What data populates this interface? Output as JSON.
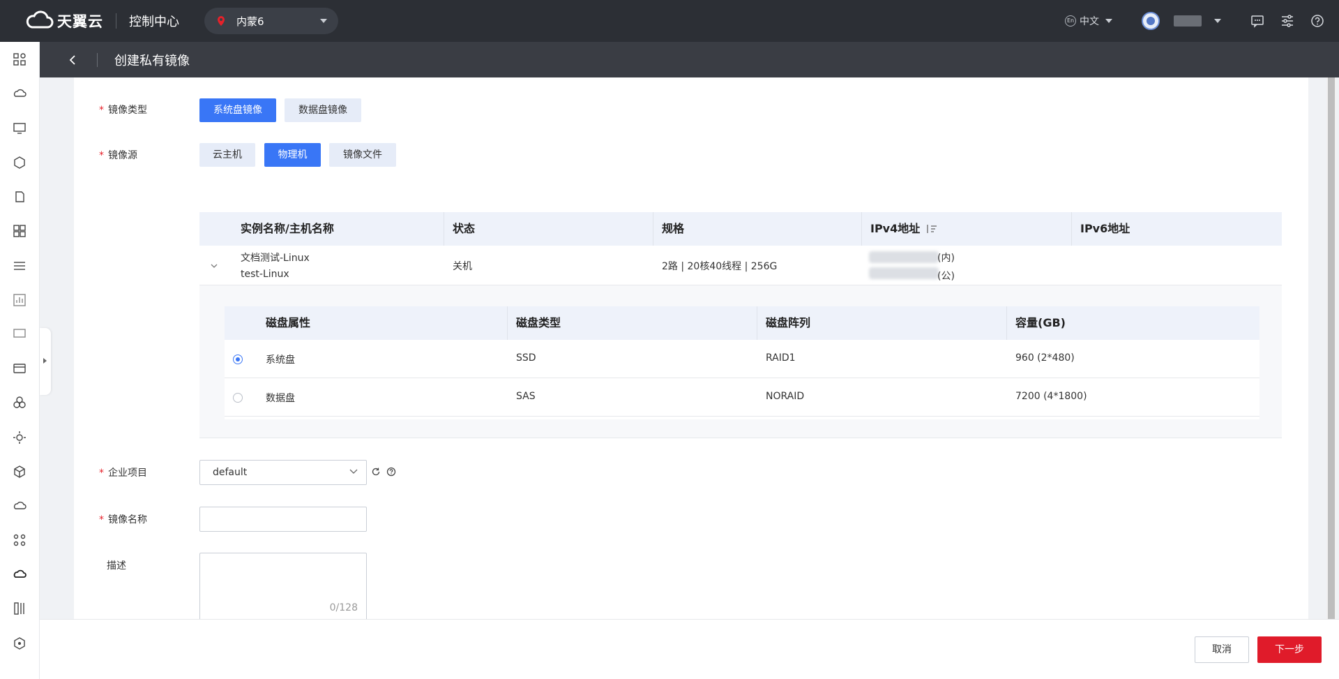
{
  "topbar": {
    "brand": "天翼云",
    "console_title": "控制中心",
    "region": "内蒙6",
    "lang_badge": "En",
    "language": "中文"
  },
  "subheader": {
    "title": "创建私有镜像"
  },
  "form": {
    "image_type": {
      "label": "镜像类型",
      "options": [
        "系统盘镜像",
        "数据盘镜像"
      ],
      "selected": "系统盘镜像"
    },
    "image_source": {
      "label": "镜像源",
      "options": [
        "云主机",
        "物理机",
        "镜像文件"
      ],
      "selected": "物理机"
    },
    "enterprise_project": {
      "label": "企业项目",
      "value": "default"
    },
    "image_name": {
      "label": "镜像名称",
      "value": ""
    },
    "description": {
      "label": "描述",
      "value": "",
      "counter": "0/128"
    }
  },
  "host_table": {
    "columns": [
      "实例名称/主机名称",
      "状态",
      "规格",
      "IPv4地址",
      "IPv6地址"
    ],
    "rows": [
      {
        "instance_name": "文档测试-Linux",
        "host_name": "test-Linux",
        "status": "关机",
        "spec": "2路 | 20核40线程 | 256G",
        "ipv4_inner_suffix": "(内)",
        "ipv4_public_suffix": "(公)",
        "ipv6": ""
      }
    ]
  },
  "disk_table": {
    "columns": [
      "磁盘属性",
      "磁盘类型",
      "磁盘阵列",
      "容量(GB)"
    ],
    "rows": [
      {
        "attr": "系统盘",
        "type": "SSD",
        "raid": "RAID1",
        "capacity": "960 (2*480)",
        "selected": true
      },
      {
        "attr": "数据盘",
        "type": "SAS",
        "raid": "NORAID",
        "capacity": "7200 (4*1800)",
        "selected": false
      }
    ]
  },
  "footer": {
    "cancel": "取消",
    "next": "下一步"
  },
  "colors": {
    "primary": "#3976f6",
    "danger": "#e01b2a",
    "topbar": "#2c2f35"
  }
}
